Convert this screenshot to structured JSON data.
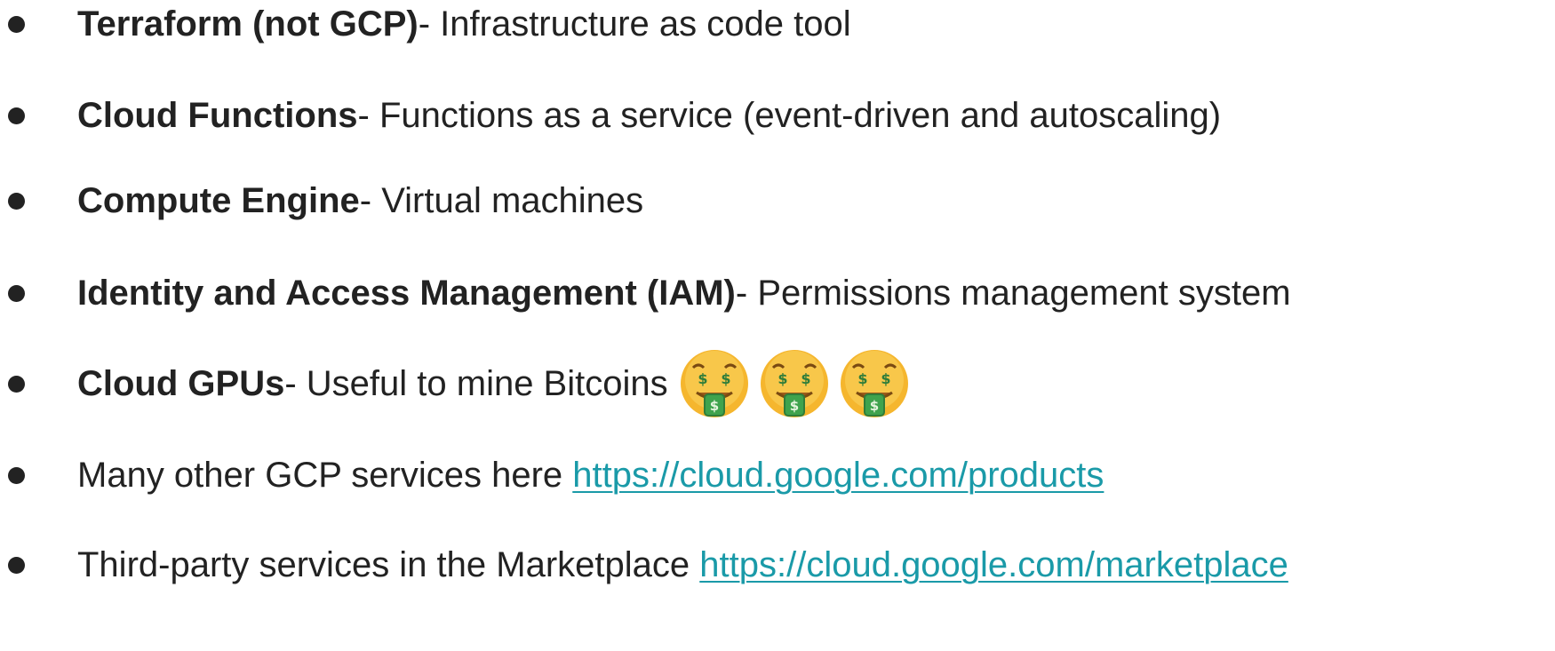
{
  "items": [
    {
      "title": "Terraform (not GCP)",
      "desc": " - Infrastructure as code tool"
    },
    {
      "title": "Cloud Functions",
      "desc": " - Functions as a service (event-driven and autoscaling)"
    },
    {
      "title": "Compute Engine",
      "desc": " - Virtual machines"
    },
    {
      "title": "Identity and Access Management (IAM)",
      "desc": " - Permissions management system"
    },
    {
      "title": "Cloud GPUs",
      "desc": " - Useful to mine Bitcoins"
    },
    {
      "text": "Many other GCP services here ",
      "link": "https://cloud.google.com/products"
    },
    {
      "text": "Third-party services in the Marketplace ",
      "link": "https://cloud.google.com/marketplace"
    }
  ],
  "emojis": [
    "money-mouth-face",
    "money-mouth-face",
    "money-mouth-face"
  ],
  "colors": {
    "text": "#222222",
    "link": "#1a9aa8",
    "emoji_face": "#f5b62e",
    "emoji_money": "#3fa34d"
  }
}
